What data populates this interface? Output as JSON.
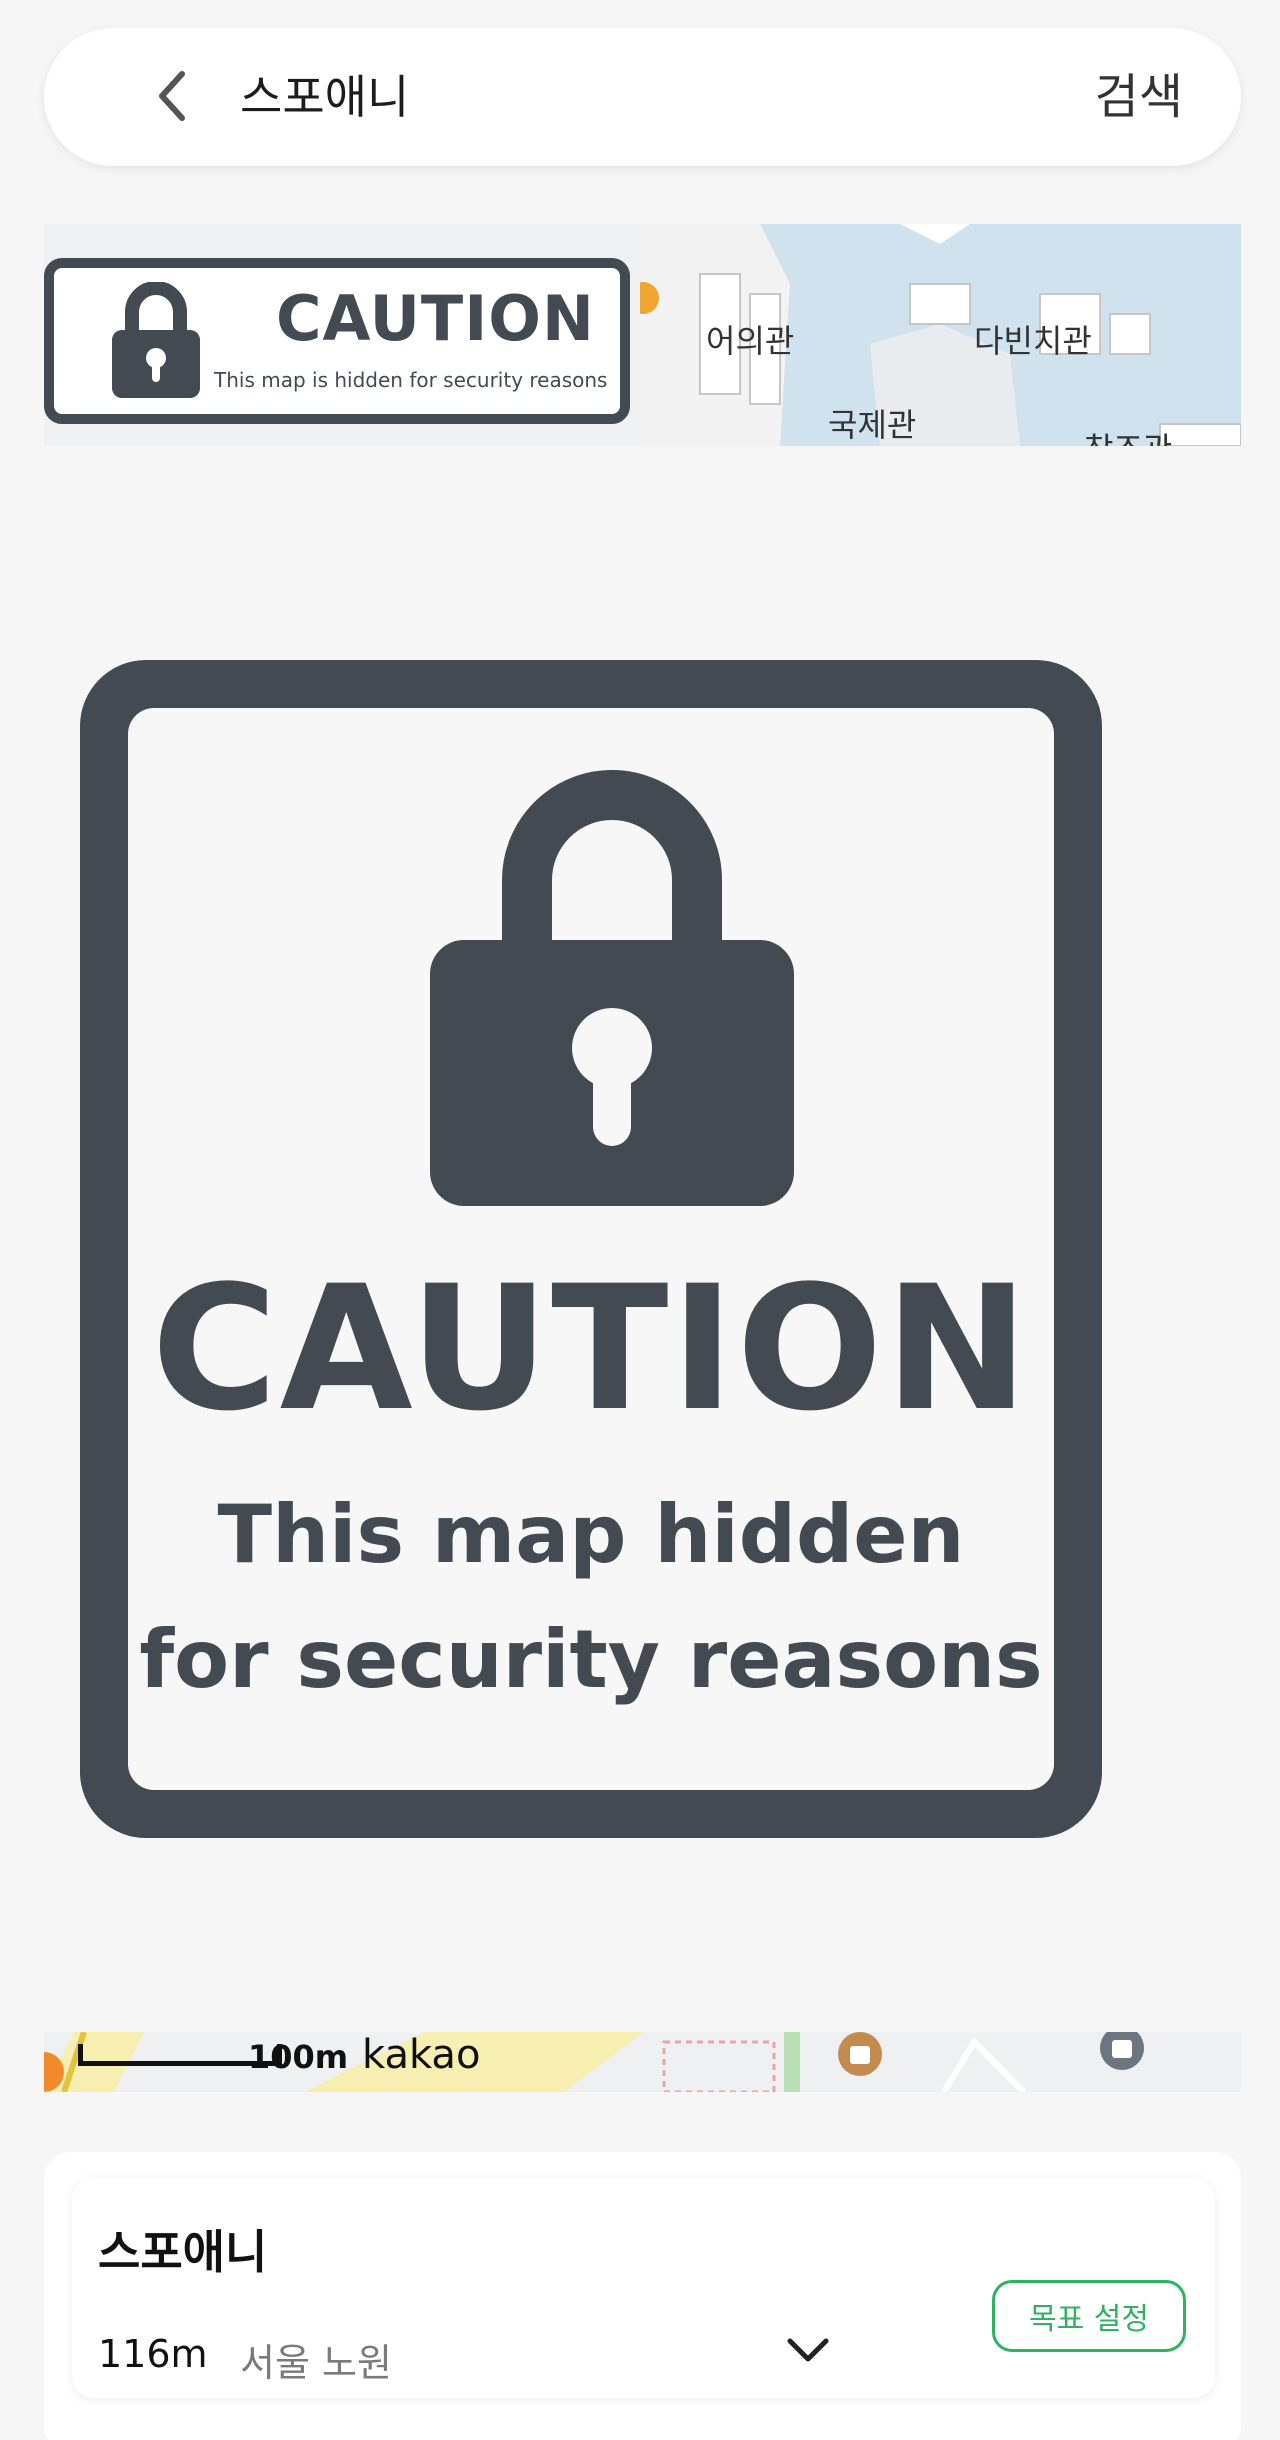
{
  "search_bar": {
    "back_icon": "chevron-left-icon",
    "query": "스포애니",
    "search_label": "검색"
  },
  "map_top": {
    "labels": [
      "어의관",
      "다빈치관",
      "국제관",
      "창조관"
    ]
  },
  "small_caution": {
    "title": "CAUTION",
    "subtitle": "This map is hidden for security reasons",
    "icon": "lock-icon"
  },
  "big_caution": {
    "title": "CAUTION",
    "line1": "This map hidden",
    "line2": "for security reasons",
    "icon": "lock-icon"
  },
  "map_bottom": {
    "scale": "100m",
    "logo": "kakao"
  },
  "result": {
    "name": "스포애니",
    "distance": "116m",
    "address": "서울 노원",
    "expand_icon": "chevron-down-icon",
    "goal_button": "목표 설정"
  },
  "colors": {
    "caution_dark": "#434a52",
    "accent_green": "#2eb360",
    "water": "#cfe2ee"
  }
}
